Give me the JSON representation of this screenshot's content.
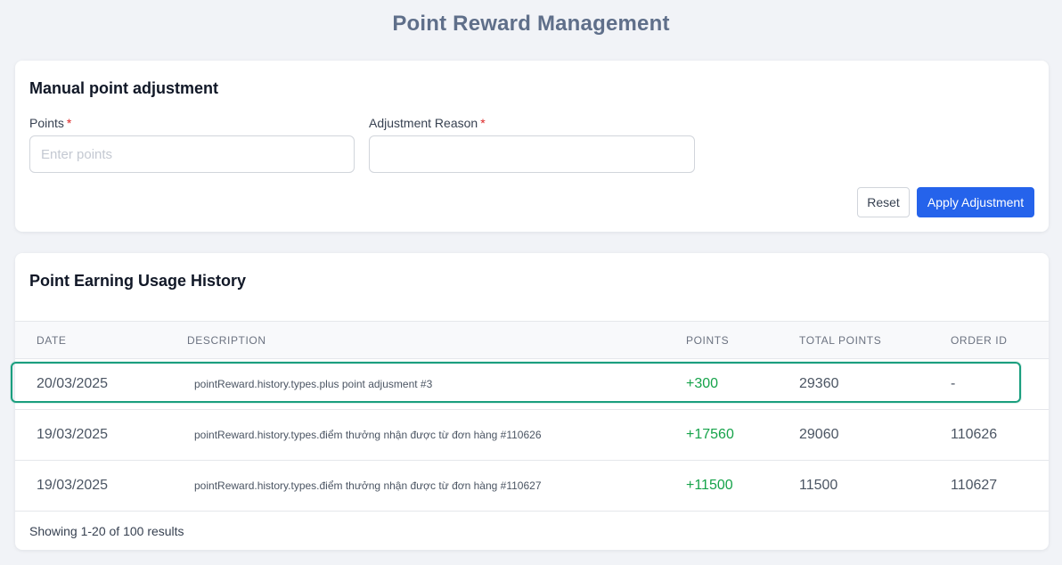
{
  "page": {
    "title": "Point Reward Management"
  },
  "adjustment": {
    "title": "Manual point adjustment",
    "points_label": "Points",
    "points_required": "*",
    "points_placeholder": "Enter points",
    "points_value": "",
    "reason_label": "Adjustment Reason",
    "reason_required": "*",
    "reason_placeholder": "",
    "reason_value": "",
    "reset_label": "Reset",
    "apply_label": "Apply Adjustment"
  },
  "history": {
    "title": "Point Earning Usage History",
    "columns": {
      "date": "DATE",
      "description": "DESCRIPTION",
      "points": "POINTS",
      "total_points": "TOTAL POINTS",
      "order_id": "ORDER ID"
    },
    "rows": [
      {
        "date": "20/03/2025",
        "description": "pointReward.history.types.plus point adjusment #3",
        "points": "+300",
        "total_points": "29360",
        "order_id": "-"
      },
      {
        "date": "19/03/2025",
        "description": "pointReward.history.types.điểm thưởng nhận được từ đơn hàng #110626",
        "points": "+17560",
        "total_points": "29060",
        "order_id": "110626"
      },
      {
        "date": "19/03/2025",
        "description": "pointReward.history.types.điểm thưởng nhận được từ đơn hàng #110627",
        "points": "+11500",
        "total_points": "11500",
        "order_id": "110627"
      }
    ],
    "status": "Showing 1-20 of 100 results"
  },
  "colors": {
    "background": "#f1f3f7",
    "primary": "#2563eb",
    "positive_points": "#16a34a",
    "highlight_border": "#1a9e7e",
    "required": "#dc2626"
  }
}
